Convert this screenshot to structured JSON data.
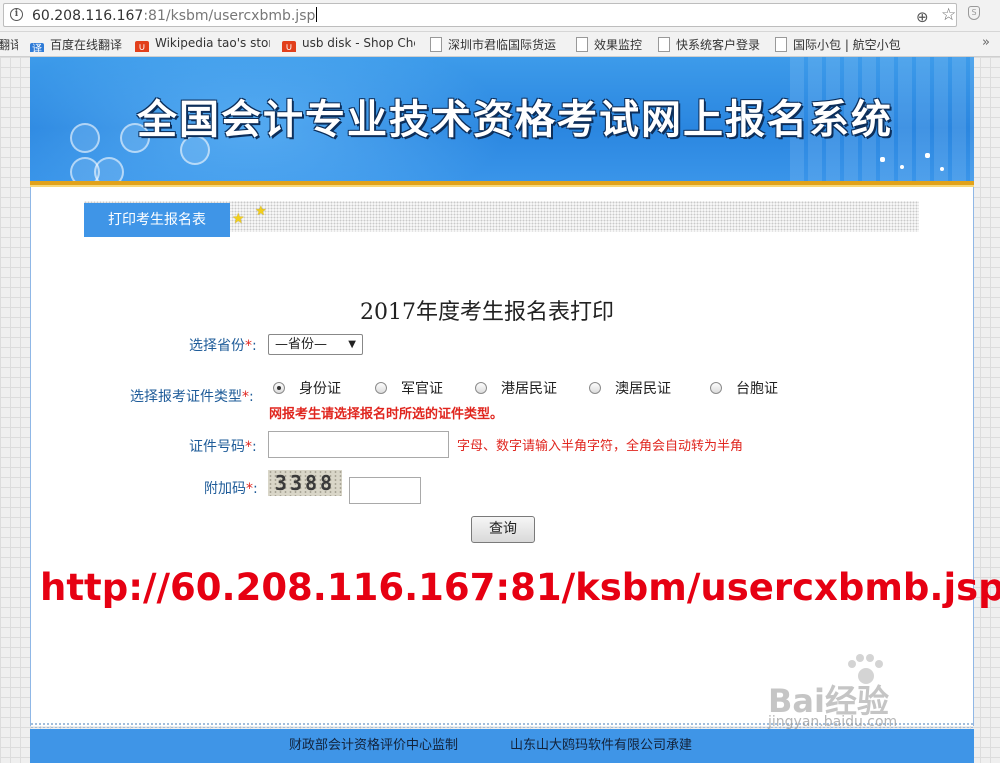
{
  "browser": {
    "url_host": "60.208.116.167",
    "url_rest": ":81/ksbm/usercxbmb.jsp",
    "info_glyph": "i",
    "zoom_glyph": "⊕",
    "star_glyph": "☆",
    "ext_glyph": "S"
  },
  "bookmarks": {
    "items": [
      {
        "label": "翻译",
        "icon": "none"
      },
      {
        "label": "百度在线翻译",
        "icon": "translate-icon",
        "glyph": "译"
      },
      {
        "label": "Wikipedia tao's stor",
        "icon": "taobao-icon",
        "glyph": "∪"
      },
      {
        "label": "usb disk - Shop Che",
        "icon": "taobao-icon",
        "glyph": "∪"
      },
      {
        "label": "深圳市君临国际货运",
        "icon": "page-icon"
      },
      {
        "label": "效果监控",
        "icon": "page-icon"
      },
      {
        "label": "快系统客户登录",
        "icon": "page-icon"
      },
      {
        "label": "国际小包 | 航空小包",
        "icon": "page-icon"
      }
    ],
    "more": "»"
  },
  "banner": {
    "title": "全国会计专业技术资格考试网上报名系统"
  },
  "tab": {
    "label": "打印考生报名表",
    "star_glyph": "★"
  },
  "form": {
    "title": "2017年度考生报名表打印",
    "required_mark": "*",
    "colon": ":",
    "province": {
      "label": "选择省份",
      "selected": "—省份—",
      "arrow": "▼"
    },
    "id_type": {
      "label": "选择报考证件类型",
      "options": [
        "身份证",
        "军官证",
        "港居民证",
        "澳居民证",
        "台胞证"
      ],
      "selected_index": 0,
      "hint": "网报考生请选择报名时所选的证件类型。"
    },
    "id_number": {
      "label": "证件号码",
      "value": "",
      "hint": "字母、数字请输入半角字符，全角会自动转为半角"
    },
    "captcha": {
      "label": "附加码",
      "image_text": "3388",
      "value": ""
    },
    "submit_label": "查询"
  },
  "annotation": {
    "url_overlay": "http://60.208.116.167:81/ksbm/usercxbmb.jsp"
  },
  "footer": {
    "supervisor": "财政部会计资格评价中心监制",
    "builder": "山东山大鸥玛软件有限公司承建"
  },
  "watermark": {
    "logo": "Bai经验",
    "sub": "jingyan.baidu.com"
  },
  "colors": {
    "accent_blue": "#3f95e7",
    "required_red": "#e0261f",
    "overlay_red": "#e60012",
    "label_blue": "#1f5c99"
  }
}
